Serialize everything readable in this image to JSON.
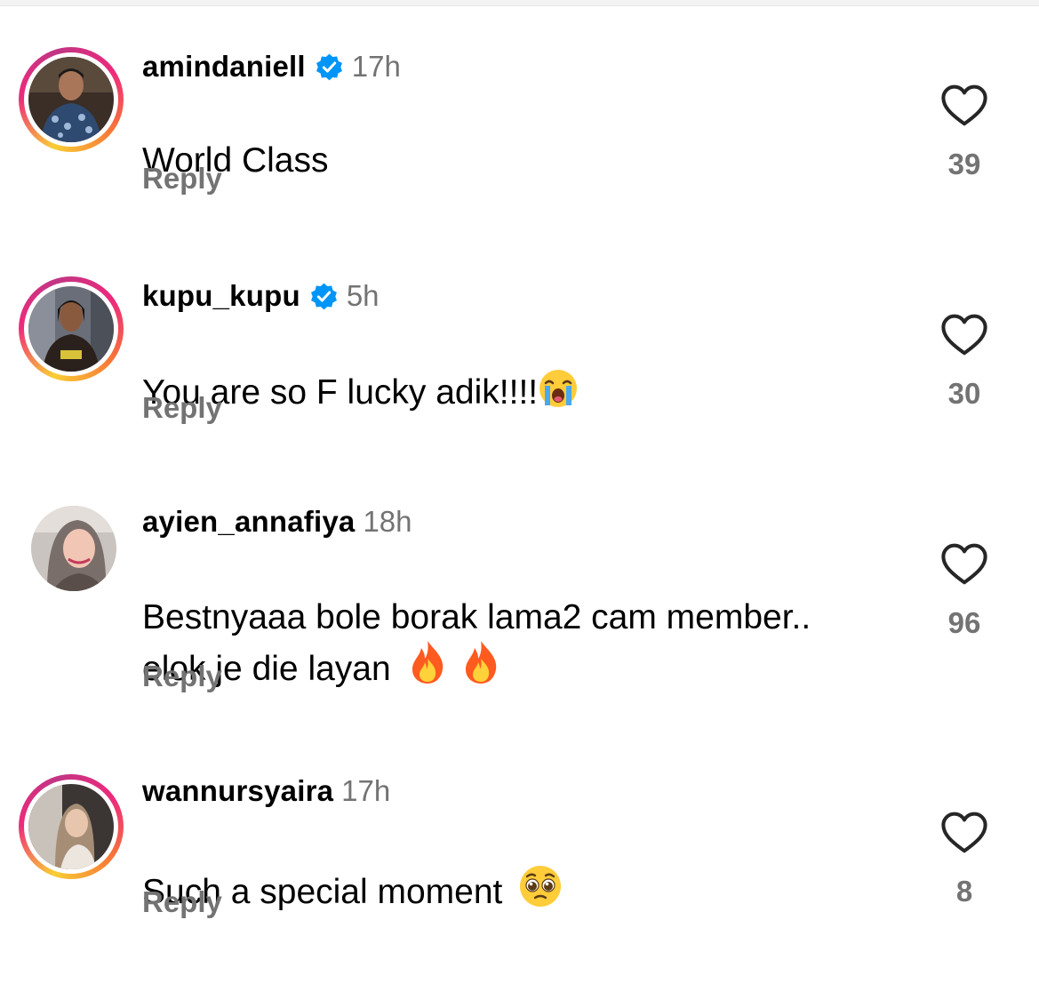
{
  "comments": [
    {
      "username": "amindaniell",
      "verified": true,
      "time": "17h",
      "text": "World Class",
      "emoji": "",
      "reply_label": "Reply",
      "likes": "39",
      "has_story": true
    },
    {
      "username": "kupu_kupu",
      "verified": true,
      "time": "5h",
      "text": "You are so F lucky adik!!!!",
      "emoji": "loudly-crying-face",
      "reply_label": "Reply",
      "likes": "30",
      "has_story": true
    },
    {
      "username": "ayien_annafiya",
      "verified": false,
      "time": "18h",
      "text": "Bestnyaaa bole borak lama2 cam member..\nelok je die layan",
      "emoji": "fire fire",
      "reply_label": "Reply",
      "likes": "96",
      "has_story": false
    },
    {
      "username": "wannursyaira",
      "verified": false,
      "time": "17h",
      "text": "Such a special moment",
      "emoji": "pleading-face",
      "reply_label": "Reply",
      "likes": "8",
      "has_story": true
    }
  ],
  "colors": {
    "verified_badge": "#0095f6",
    "muted_text": "#737373",
    "story_ring_start": "#f9ce34",
    "story_ring_end": "#c13584"
  },
  "icons": {
    "verified": "verified-badge-icon",
    "like": "heart-outline-icon"
  }
}
